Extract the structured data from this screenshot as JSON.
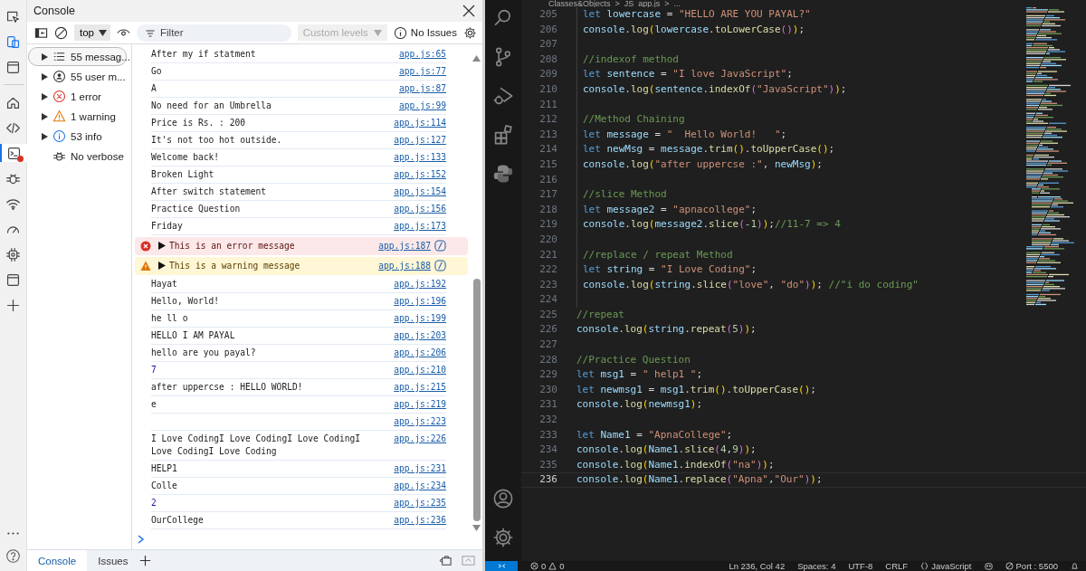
{
  "devtools": {
    "tool_strip": [
      {
        "kind": "inspect",
        "on": false,
        "selected": false,
        "alert": false
      },
      {
        "kind": "device",
        "on": true,
        "selected": false,
        "alert": false
      },
      {
        "kind": "window",
        "on": false,
        "selected": false,
        "alert": false
      },
      {
        "kind": "home",
        "on": false,
        "selected": false,
        "alert": false
      },
      {
        "kind": "code",
        "on": false,
        "selected": false,
        "alert": false
      },
      {
        "kind": "console",
        "on": false,
        "selected": true,
        "alert": true
      },
      {
        "kind": "bug",
        "on": false,
        "selected": false,
        "alert": false
      },
      {
        "kind": "wifi",
        "on": false,
        "selected": false,
        "alert": false
      },
      {
        "kind": "gauge",
        "on": false,
        "selected": false,
        "alert": false
      },
      {
        "kind": "chip",
        "on": false,
        "selected": false,
        "alert": false
      },
      {
        "kind": "window",
        "on": false,
        "selected": false,
        "alert": false
      },
      {
        "kind": "plus",
        "on": false,
        "selected": false,
        "alert": false
      }
    ],
    "title": "Console",
    "toolbar": {
      "context": "top",
      "filter_placeholder": "Filter",
      "levels": "Custom levels",
      "levels_disabled": true,
      "issues": "No Issues"
    },
    "sidebar": [
      {
        "kind": "messages",
        "label": "55 messag...",
        "expandable": true,
        "selected": true
      },
      {
        "kind": "user",
        "label": "55 user m...",
        "expandable": true,
        "selected": false
      },
      {
        "kind": "errors",
        "label": "1 error",
        "expandable": true,
        "selected": false
      },
      {
        "kind": "warnings",
        "label": "1 warning",
        "expandable": true,
        "selected": false
      },
      {
        "kind": "info",
        "label": "53 info",
        "expandable": true,
        "selected": false
      },
      {
        "kind": "verbose",
        "label": "No verbose",
        "expandable": false,
        "selected": false
      }
    ],
    "rows": [
      {
        "kind": "log",
        "message": "After my if statment",
        "source": "app.js:65"
      },
      {
        "kind": "log",
        "message": "Go",
        "source": "app.js:77"
      },
      {
        "kind": "log",
        "message": "A",
        "source": "app.js:87"
      },
      {
        "kind": "log",
        "message": "No need for an Umbrella",
        "source": "app.js:99"
      },
      {
        "kind": "log",
        "message": "Price is Rs. : 200",
        "source": "app.js:114"
      },
      {
        "kind": "log",
        "message": "It's not too hot outside.",
        "source": "app.js:127"
      },
      {
        "kind": "log",
        "message": "Welcome back!",
        "source": "app.js:133"
      },
      {
        "kind": "log",
        "message": "Broken Light",
        "source": "app.js:152"
      },
      {
        "kind": "log",
        "message": "After switch statement",
        "source": "app.js:154"
      },
      {
        "kind": "log",
        "message": "Practice Question",
        "source": "app.js:156"
      },
      {
        "kind": "log",
        "message": "Friday",
        "source": "app.js:173"
      },
      {
        "kind": "error",
        "message": "This is an error message",
        "source": "app.js:187"
      },
      {
        "kind": "warning",
        "message": "This is a warning message",
        "source": "app.js:188"
      },
      {
        "kind": "log",
        "message": "Hayat",
        "source": "app.js:192"
      },
      {
        "kind": "log",
        "message": "Hello, World!",
        "source": "app.js:196"
      },
      {
        "kind": "log",
        "message": "he ll o",
        "source": "app.js:199"
      },
      {
        "kind": "log",
        "message": "HELLO I AM PAYAL",
        "source": "app.js:203"
      },
      {
        "kind": "log",
        "message": "hello are you payal?",
        "source": "app.js:206"
      },
      {
        "kind": "number",
        "message": "7",
        "source": "app.js:210"
      },
      {
        "kind": "log",
        "message": "after uppercse : HELLO WORLD!",
        "source": "app.js:215"
      },
      {
        "kind": "log",
        "message": "e",
        "source": "app.js:219"
      },
      {
        "kind": "log",
        "source": "app.js:223"
      },
      {
        "kind": "log",
        "message": "I Love CodingI Love CodingI Love CodingI Love CodingI Love Coding",
        "source": "app.js:226"
      },
      {
        "kind": "log",
        "message": "HELP1",
        "source": "app.js:231"
      },
      {
        "kind": "log",
        "message": "Colle",
        "source": "app.js:234"
      },
      {
        "kind": "number",
        "message": "2",
        "source": "app.js:235"
      },
      {
        "kind": "log",
        "message": "OurCollege",
        "source": "app.js:236"
      }
    ],
    "bottom_tabs": [
      {
        "label": "Console",
        "selected": true
      },
      {
        "label": "Issues",
        "selected": false
      }
    ]
  },
  "editor": {
    "breadcrumb": [
      "Classes&Objects",
      ">",
      "JS",
      "app.js",
      ">",
      "..."
    ],
    "lines": [
      {
        "number": "205",
        "indented": true,
        "current": false,
        "tokens": [
          {
            "kind": "keyword",
            "text": "let"
          },
          {
            "kind": "variable",
            "text": " lowercase"
          },
          {
            "kind": "plain",
            "text": " = "
          },
          {
            "kind": "string",
            "text": "\"HELLO ARE YOU PAYAL?\""
          }
        ]
      },
      {
        "number": "206",
        "indented": true,
        "current": false,
        "tokens": [
          {
            "kind": "variable",
            "text": "console"
          },
          {
            "kind": "plain",
            "text": "."
          },
          {
            "kind": "function",
            "text": "log"
          },
          {
            "kind": "bracket1",
            "text": "("
          },
          {
            "kind": "variable",
            "text": "lowercase"
          },
          {
            "kind": "plain",
            "text": "."
          },
          {
            "kind": "function",
            "text": "toLowerCase"
          },
          {
            "kind": "bracket2",
            "text": "()"
          },
          {
            "kind": "bracket1",
            "text": ")"
          },
          {
            "kind": "plain",
            "text": ";"
          }
        ]
      },
      {
        "number": "207",
        "indented": true,
        "current": false
      },
      {
        "number": "208",
        "indented": true,
        "current": false,
        "tokens": [
          {
            "kind": "comment",
            "text": "//indexof method"
          }
        ]
      },
      {
        "number": "209",
        "indented": true,
        "current": false,
        "tokens": [
          {
            "kind": "keyword",
            "text": "let"
          },
          {
            "kind": "variable",
            "text": " sentence"
          },
          {
            "kind": "plain",
            "text": " = "
          },
          {
            "kind": "string",
            "text": "\"I love JavaScript\""
          },
          {
            "kind": "plain",
            "text": ";"
          }
        ]
      },
      {
        "number": "210",
        "indented": true,
        "current": false,
        "tokens": [
          {
            "kind": "variable",
            "text": "console"
          },
          {
            "kind": "plain",
            "text": "."
          },
          {
            "kind": "function",
            "text": "log"
          },
          {
            "kind": "bracket1",
            "text": "("
          },
          {
            "kind": "variable",
            "text": "sentence"
          },
          {
            "kind": "plain",
            "text": "."
          },
          {
            "kind": "function",
            "text": "indexOf"
          },
          {
            "kind": "bracket2",
            "text": "("
          },
          {
            "kind": "string",
            "text": "\"JavaScript\""
          },
          {
            "kind": "bracket2",
            "text": ")"
          },
          {
            "kind": "bracket1",
            "text": ")"
          },
          {
            "kind": "plain",
            "text": ";"
          }
        ]
      },
      {
        "number": "211",
        "indented": true,
        "current": false
      },
      {
        "number": "212",
        "indented": true,
        "current": false,
        "tokens": [
          {
            "kind": "comment",
            "text": "//Method Chaining"
          }
        ]
      },
      {
        "number": "213",
        "indented": true,
        "current": false,
        "tokens": [
          {
            "kind": "keyword",
            "text": "let"
          },
          {
            "kind": "variable",
            "text": " message"
          },
          {
            "kind": "plain",
            "text": " = "
          },
          {
            "kind": "string",
            "text": "\"  Hello World!   \""
          },
          {
            "kind": "plain",
            "text": ";"
          }
        ]
      },
      {
        "number": "214",
        "indented": true,
        "current": false,
        "tokens": [
          {
            "kind": "keyword",
            "text": "let"
          },
          {
            "kind": "variable",
            "text": " newMsg"
          },
          {
            "kind": "plain",
            "text": " = "
          },
          {
            "kind": "variable",
            "text": "message"
          },
          {
            "kind": "plain",
            "text": "."
          },
          {
            "kind": "function",
            "text": "trim"
          },
          {
            "kind": "bracket1",
            "text": "()"
          },
          {
            "kind": "plain",
            "text": "."
          },
          {
            "kind": "function",
            "text": "toUpperCase"
          },
          {
            "kind": "bracket1",
            "text": "()"
          },
          {
            "kind": "plain",
            "text": ";"
          }
        ]
      },
      {
        "number": "215",
        "indented": true,
        "current": false,
        "tokens": [
          {
            "kind": "variable",
            "text": "console"
          },
          {
            "kind": "plain",
            "text": "."
          },
          {
            "kind": "function",
            "text": "log"
          },
          {
            "kind": "bracket1",
            "text": "("
          },
          {
            "kind": "string",
            "text": "\"after uppercse :\""
          },
          {
            "kind": "plain",
            "text": ", "
          },
          {
            "kind": "variable",
            "text": "newMsg"
          },
          {
            "kind": "bracket1",
            "text": ")"
          },
          {
            "kind": "plain",
            "text": ";"
          }
        ]
      },
      {
        "number": "216",
        "indented": true,
        "current": false
      },
      {
        "number": "217",
        "indented": true,
        "current": false,
        "tokens": [
          {
            "kind": "comment",
            "text": "//slice Method"
          }
        ]
      },
      {
        "number": "218",
        "indented": true,
        "current": false,
        "tokens": [
          {
            "kind": "keyword",
            "text": "let"
          },
          {
            "kind": "variable",
            "text": " message2"
          },
          {
            "kind": "plain",
            "text": " = "
          },
          {
            "kind": "string",
            "text": "\"apnacollege\""
          },
          {
            "kind": "plain",
            "text": ";"
          }
        ]
      },
      {
        "number": "219",
        "indented": true,
        "current": false,
        "tokens": [
          {
            "kind": "variable",
            "text": "console"
          },
          {
            "kind": "plain",
            "text": "."
          },
          {
            "kind": "function",
            "text": "log"
          },
          {
            "kind": "bracket1",
            "text": "("
          },
          {
            "kind": "variable",
            "text": "message2"
          },
          {
            "kind": "plain",
            "text": "."
          },
          {
            "kind": "function",
            "text": "slice"
          },
          {
            "kind": "bracket2",
            "text": "("
          },
          {
            "kind": "number",
            "text": "-1"
          },
          {
            "kind": "bracket2",
            "text": ")"
          },
          {
            "kind": "bracket1",
            "text": ")"
          },
          {
            "kind": "plain",
            "text": ";"
          },
          {
            "kind": "comment",
            "text": "//11-7 => 4"
          }
        ]
      },
      {
        "number": "220",
        "indented": true,
        "current": false
      },
      {
        "number": "221",
        "indented": true,
        "current": false,
        "tokens": [
          {
            "kind": "comment",
            "text": "//replace / repeat Method"
          }
        ]
      },
      {
        "number": "222",
        "indented": true,
        "current": false,
        "tokens": [
          {
            "kind": "keyword",
            "text": "let"
          },
          {
            "kind": "variable",
            "text": " string"
          },
          {
            "kind": "plain",
            "text": " = "
          },
          {
            "kind": "string",
            "text": "\"I Love Coding\""
          },
          {
            "kind": "plain",
            "text": ";"
          }
        ]
      },
      {
        "number": "223",
        "indented": true,
        "current": false,
        "tokens": [
          {
            "kind": "variable",
            "text": "console"
          },
          {
            "kind": "plain",
            "text": "."
          },
          {
            "kind": "function",
            "text": "log"
          },
          {
            "kind": "bracket1",
            "text": "("
          },
          {
            "kind": "variable",
            "text": "string"
          },
          {
            "kind": "plain",
            "text": "."
          },
          {
            "kind": "function",
            "text": "slice"
          },
          {
            "kind": "bracket2",
            "text": "("
          },
          {
            "kind": "string",
            "text": "\"love\""
          },
          {
            "kind": "plain",
            "text": ", "
          },
          {
            "kind": "string",
            "text": "\"do\""
          },
          {
            "kind": "bracket2",
            "text": ")"
          },
          {
            "kind": "bracket1",
            "text": ")"
          },
          {
            "kind": "plain",
            "text": "; "
          },
          {
            "kind": "comment",
            "text": "//\"i do coding\""
          }
        ]
      },
      {
        "number": "224",
        "indented": true,
        "current": false
      },
      {
        "number": "225",
        "indented": false,
        "current": false,
        "tokens": [
          {
            "kind": "comment",
            "text": "//repeat"
          }
        ]
      },
      {
        "number": "226",
        "indented": false,
        "current": false,
        "tokens": [
          {
            "kind": "variable",
            "text": "console"
          },
          {
            "kind": "plain",
            "text": "."
          },
          {
            "kind": "function",
            "text": "log"
          },
          {
            "kind": "bracket1",
            "text": "("
          },
          {
            "kind": "variable",
            "text": "string"
          },
          {
            "kind": "plain",
            "text": "."
          },
          {
            "kind": "function",
            "text": "repeat"
          },
          {
            "kind": "bracket2",
            "text": "("
          },
          {
            "kind": "number",
            "text": "5"
          },
          {
            "kind": "bracket2",
            "text": ")"
          },
          {
            "kind": "bracket1",
            "text": ")"
          },
          {
            "kind": "plain",
            "text": ";"
          }
        ]
      },
      {
        "number": "227",
        "indented": false,
        "current": false
      },
      {
        "number": "228",
        "indented": false,
        "current": false,
        "tokens": [
          {
            "kind": "comment",
            "text": "//Practice Question"
          }
        ]
      },
      {
        "number": "229",
        "indented": false,
        "current": false,
        "tokens": [
          {
            "kind": "keyword",
            "text": "let"
          },
          {
            "kind": "variable",
            "text": " msg1"
          },
          {
            "kind": "plain",
            "text": " = "
          },
          {
            "kind": "string",
            "text": "\" help1 \""
          },
          {
            "kind": "plain",
            "text": ";"
          }
        ]
      },
      {
        "number": "230",
        "indented": false,
        "current": false,
        "tokens": [
          {
            "kind": "keyword",
            "text": "let"
          },
          {
            "kind": "variable",
            "text": " newmsg1"
          },
          {
            "kind": "plain",
            "text": " = "
          },
          {
            "kind": "variable",
            "text": "msg1"
          },
          {
            "kind": "plain",
            "text": "."
          },
          {
            "kind": "function",
            "text": "trim"
          },
          {
            "kind": "bracket1",
            "text": "()"
          },
          {
            "kind": "plain",
            "text": "."
          },
          {
            "kind": "function",
            "text": "toUpperCase"
          },
          {
            "kind": "bracket1",
            "text": "()"
          },
          {
            "kind": "plain",
            "text": ";"
          }
        ]
      },
      {
        "number": "231",
        "indented": false,
        "current": false,
        "tokens": [
          {
            "kind": "variable",
            "text": "console"
          },
          {
            "kind": "plain",
            "text": "."
          },
          {
            "kind": "function",
            "text": "log"
          },
          {
            "kind": "bracket1",
            "text": "("
          },
          {
            "kind": "variable",
            "text": "newmsg1"
          },
          {
            "kind": "bracket1",
            "text": ")"
          },
          {
            "kind": "plain",
            "text": ";"
          }
        ]
      },
      {
        "number": "232",
        "indented": false,
        "current": false
      },
      {
        "number": "233",
        "indented": false,
        "current": false,
        "tokens": [
          {
            "kind": "keyword",
            "text": "let"
          },
          {
            "kind": "variable",
            "text": " Name1"
          },
          {
            "kind": "plain",
            "text": " = "
          },
          {
            "kind": "string",
            "text": "\"ApnaCollege\""
          },
          {
            "kind": "plain",
            "text": ";"
          }
        ]
      },
      {
        "number": "234",
        "indented": false,
        "current": false,
        "tokens": [
          {
            "kind": "variable",
            "text": "console"
          },
          {
            "kind": "plain",
            "text": "."
          },
          {
            "kind": "function",
            "text": "log"
          },
          {
            "kind": "bracket1",
            "text": "("
          },
          {
            "kind": "variable",
            "text": "Name1"
          },
          {
            "kind": "plain",
            "text": "."
          },
          {
            "kind": "function",
            "text": "slice"
          },
          {
            "kind": "bracket2",
            "text": "("
          },
          {
            "kind": "number",
            "text": "4"
          },
          {
            "kind": "plain",
            "text": ","
          },
          {
            "kind": "number",
            "text": "9"
          },
          {
            "kind": "bracket2",
            "text": ")"
          },
          {
            "kind": "bracket1",
            "text": ")"
          },
          {
            "kind": "plain",
            "text": ";"
          }
        ]
      },
      {
        "number": "235",
        "indented": false,
        "current": false,
        "tokens": [
          {
            "kind": "variable",
            "text": "console"
          },
          {
            "kind": "plain",
            "text": "."
          },
          {
            "kind": "function",
            "text": "log"
          },
          {
            "kind": "bracket1",
            "text": "("
          },
          {
            "kind": "variable",
            "text": "Name1"
          },
          {
            "kind": "plain",
            "text": "."
          },
          {
            "kind": "function",
            "text": "indexOf"
          },
          {
            "kind": "bracket2",
            "text": "("
          },
          {
            "kind": "string",
            "text": "\"na\""
          },
          {
            "kind": "bracket2",
            "text": ")"
          },
          {
            "kind": "bracket1",
            "text": ")"
          },
          {
            "kind": "plain",
            "text": ";"
          }
        ]
      },
      {
        "number": "236",
        "indented": false,
        "current": true,
        "tokens": [
          {
            "kind": "variable",
            "text": "console"
          },
          {
            "kind": "plain",
            "text": "."
          },
          {
            "kind": "function",
            "text": "log"
          },
          {
            "kind": "bracket1",
            "text": "("
          },
          {
            "kind": "variable",
            "text": "Name1"
          },
          {
            "kind": "plain",
            "text": "."
          },
          {
            "kind": "function",
            "text": "replace"
          },
          {
            "kind": "bracket2",
            "text": "("
          },
          {
            "kind": "string",
            "text": "\"Apna\""
          },
          {
            "kind": "plain",
            "text": ","
          },
          {
            "kind": "string",
            "text": "\"Our\""
          },
          {
            "kind": "bracket2",
            "text": ")"
          },
          {
            "kind": "bracket1",
            "text": ")"
          },
          {
            "kind": "plain",
            "text": ";"
          }
        ]
      }
    ],
    "status_bar": {
      "errors": "0",
      "warnings": "0",
      "position": "Ln 236, Col 42",
      "spaces": "Spaces: 4",
      "encoding": "UTF-8",
      "eol": "CRLF",
      "language": "JavaScript",
      "port": "Port : 5500"
    }
  }
}
